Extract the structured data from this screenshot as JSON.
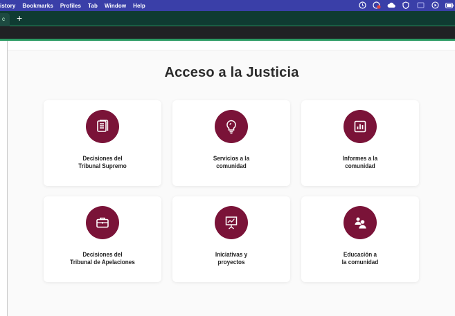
{
  "menubar": {
    "items": [
      "istory",
      "Bookmarks",
      "Profiles",
      "Tab",
      "Window",
      "Help"
    ]
  },
  "tabbar": {
    "tab_stub_label": "c",
    "new_tab_label": "+"
  },
  "page": {
    "title": "Acceso a la Justicia",
    "accent_color": "#7a1338",
    "cards": [
      {
        "icon": "document-icon",
        "line1": "Decisiones del",
        "line2": "Tribunal Supremo"
      },
      {
        "icon": "lightbulb-icon",
        "line1": "Servicios a la",
        "line2": "comunidad"
      },
      {
        "icon": "bar-chart-icon",
        "line1": "Informes a la",
        "line2": "comunidad"
      },
      {
        "icon": "briefcase-icon",
        "line1": "Decisiones del",
        "line2": "Tribunal de Apelaciones"
      },
      {
        "icon": "presentation-icon",
        "line1": "Iniciativas y",
        "line2": "proyectos"
      },
      {
        "icon": "people-icon",
        "line1": "Educación a",
        "line2": "la comunidad"
      }
    ]
  }
}
